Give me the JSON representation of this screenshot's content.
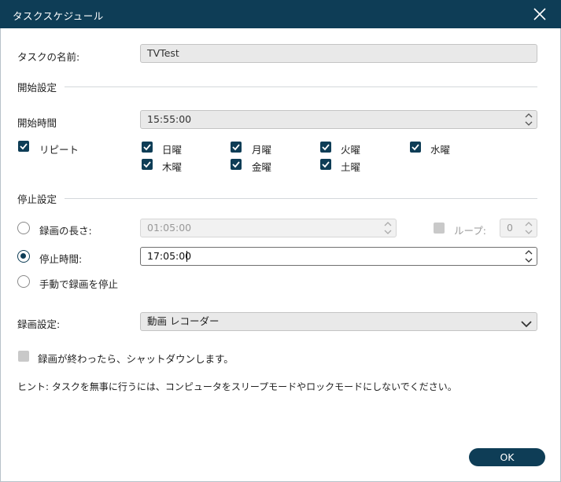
{
  "window": {
    "title": "タスクスケジュール"
  },
  "task_name": {
    "label": "タスクの名前:",
    "value": "TVTest"
  },
  "start_section": {
    "title": "開始設定",
    "start_time_label": "開始時間",
    "start_time_value": "15:55:00",
    "repeat_label": "リピート",
    "repeat_checked": true,
    "days": [
      {
        "label": "日曜",
        "checked": true
      },
      {
        "label": "月曜",
        "checked": true
      },
      {
        "label": "火曜",
        "checked": true
      },
      {
        "label": "水曜",
        "checked": true
      },
      {
        "label": "木曜",
        "checked": true
      },
      {
        "label": "金曜",
        "checked": true
      },
      {
        "label": "土曜",
        "checked": true
      }
    ]
  },
  "stop_section": {
    "title": "停止設定",
    "duration_label": "録画の長さ:",
    "duration_value": "01:05:00",
    "loop_label": "ループ:",
    "loop_value": "0",
    "stop_time_label": "停止時間:",
    "stop_time_value": "17:05:00",
    "manual_label": "手動で録画を停止",
    "selected": "stop_time"
  },
  "recording": {
    "label": "録画設定:",
    "value": "動画 レコーダー"
  },
  "shutdown": {
    "label": "録画が終わったら、シャットダウンします。",
    "checked": false
  },
  "hint": {
    "text": "ヒント: タスクを無事に行うには、コンピュータをスリープモードやロックモードにしないでください。"
  },
  "ok_button": {
    "label": "OK"
  },
  "colors": {
    "accent": "#0e3d56",
    "field_bg": "#e9e9e9",
    "disabled_check": "#c9c9c9"
  }
}
